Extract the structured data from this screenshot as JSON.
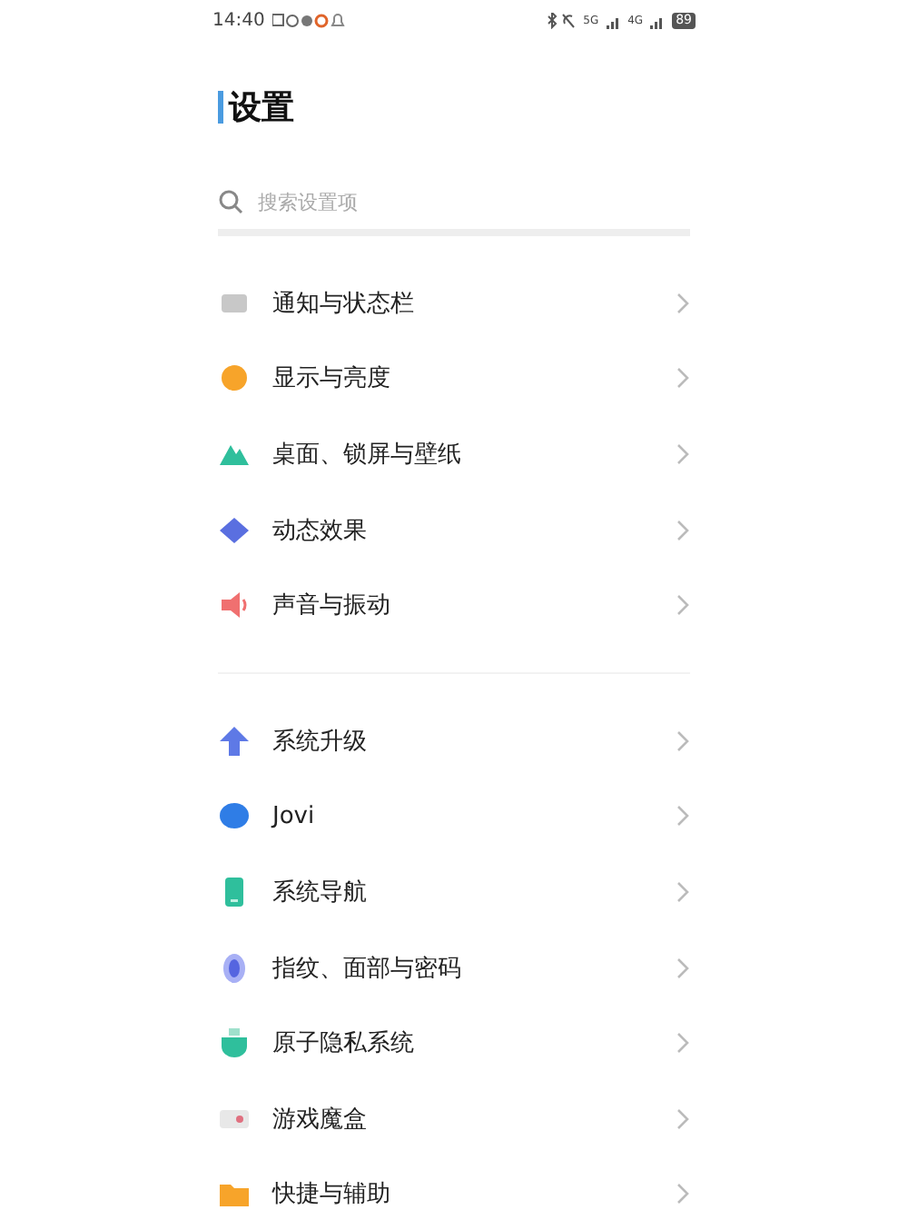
{
  "status_bar": {
    "time": "14:40",
    "network_1": "5G",
    "network_2": "4G",
    "battery": "89"
  },
  "title": "设置",
  "search": {
    "placeholder": "搜索设置项"
  },
  "groups": [
    {
      "items": [
        {
          "label": "通知与状态栏"
        },
        {
          "label": "显示与亮度"
        },
        {
          "label": "桌面、锁屏与壁纸"
        },
        {
          "label": "动态效果"
        },
        {
          "label": "声音与振动"
        }
      ]
    },
    {
      "items": [
        {
          "label": "系统升级"
        },
        {
          "label": "Jovi"
        },
        {
          "label": "系统导航"
        },
        {
          "label": "指纹、面部与密码"
        },
        {
          "label": "原子隐私系统"
        },
        {
          "label": "游戏魔盒"
        },
        {
          "label": "快捷与辅助"
        }
      ]
    }
  ]
}
